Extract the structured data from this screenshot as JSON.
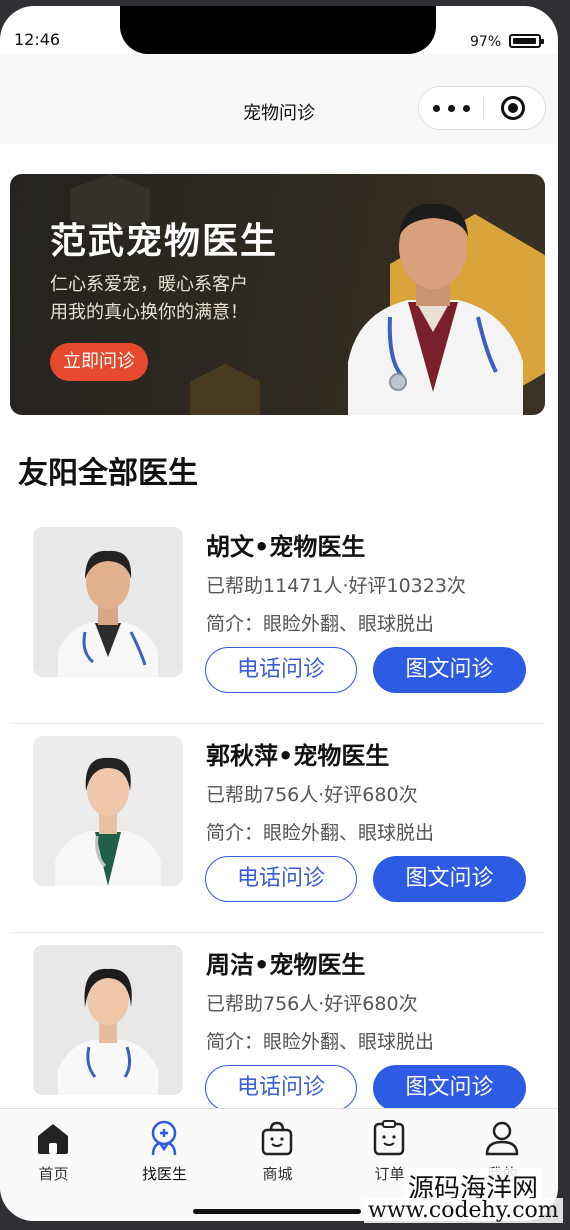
{
  "status_bar": {
    "time": "12:46",
    "battery": "97%",
    "battery_level": 0.97
  },
  "navbar": {
    "title": "宠物问诊"
  },
  "banner": {
    "title": "范武宠物医生",
    "line1": "仁心系爱宠，暖心系客户",
    "line2": "用我的真心换你的满意！",
    "button": "立即问诊"
  },
  "section_title": "友阳全部医生",
  "doctors": [
    {
      "name": "胡文•宠物医生",
      "stats": "已帮助11471人·好评10323次",
      "intro": "简介：眼睑外翻、眼球脱出",
      "phone_btn": "电话问诊",
      "chat_btn": "图文问诊"
    },
    {
      "name": "郭秋萍•宠物医生",
      "stats": "已帮助756人·好评680次",
      "intro": "简介：眼睑外翻、眼球脱出",
      "phone_btn": "电话问诊",
      "chat_btn": "图文问诊"
    },
    {
      "name": "周洁•宠物医生",
      "stats": "已帮助756人·好评680次",
      "intro": "简介：眼睑外翻、眼球脱出",
      "phone_btn": "电话问诊",
      "chat_btn": "图文问诊"
    }
  ],
  "tabbar": [
    {
      "label": "首页",
      "icon": "home-icon",
      "active": false
    },
    {
      "label": "找医生",
      "icon": "doctor-icon",
      "active": true
    },
    {
      "label": "商城",
      "icon": "shop-bag-icon",
      "active": false
    },
    {
      "label": "订单",
      "icon": "order-clipboard-icon",
      "active": false
    },
    {
      "label": "我的",
      "icon": "user-icon",
      "active": false
    }
  ],
  "watermark": {
    "line1": "源码海洋网",
    "line2": "www.codehy.com"
  },
  "colors": {
    "accent_blue": "#2d5be3",
    "banner_orange": "#e64a2e",
    "banner_gold": "#d9a43a"
  }
}
